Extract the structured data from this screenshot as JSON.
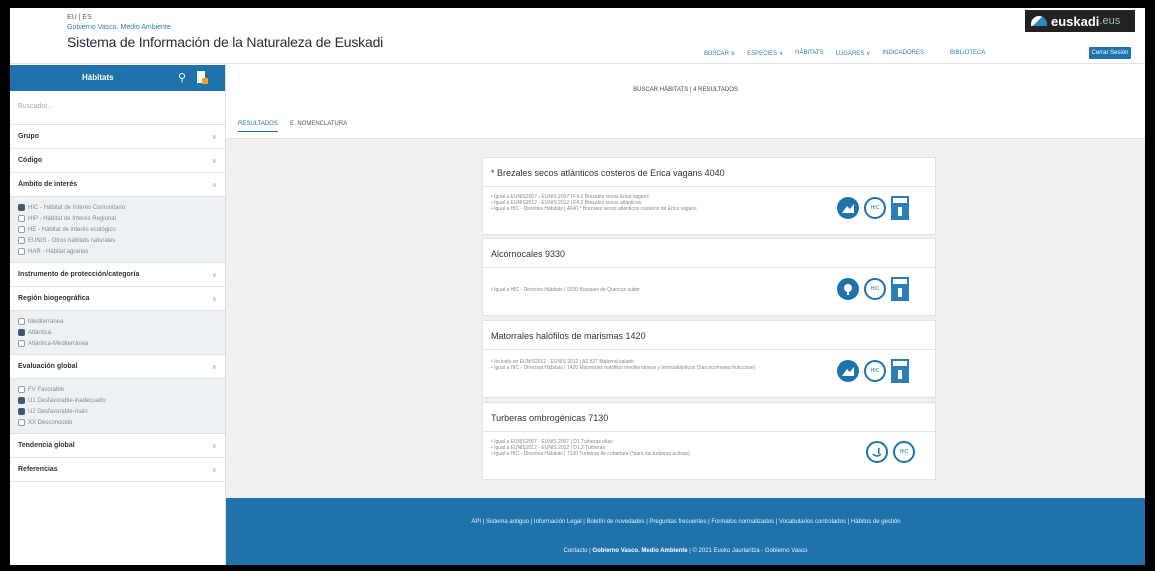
{
  "header": {
    "lang": "EU | ES",
    "gov": "Gobierno Vasco. Medio Ambiente",
    "title": "Sistema de Información de la Naturaleza de Euskadi",
    "logo_text": "euskadi",
    "logo_suffix": ".eus",
    "nav": [
      "Buscar ∨",
      "ESPECIES ∨",
      "HÁBITATS",
      "LUGARES ∨",
      "INDICADORES",
      "BIBLIOTECA"
    ],
    "session_button": "Cerrar Sesión"
  },
  "sidebar": {
    "title": "Hábitats",
    "search_placeholder": "Buscador...",
    "sections": {
      "grupo": "Grupo",
      "codigo": "Código",
      "ambito": "Ámbito de interés",
      "instrumento": "Instrumento de protección/categoría",
      "region": "Región biogeográfica",
      "evaluacion": "Evaluación global",
      "tendencia": "Tendencia global",
      "referencias": "Referencias"
    },
    "ambito_options": [
      {
        "label": "HIC - Hábitat de Interés Comunitario",
        "checked": true
      },
      {
        "label": "HIP - Hábitat de Interés Regional",
        "checked": false
      },
      {
        "label": "HE - Hábitat de interés ecológico",
        "checked": false
      },
      {
        "label": "EUNIS - Otros hábitats naturales",
        "checked": false
      },
      {
        "label": "HAR - Hábitat agrarios",
        "checked": false
      }
    ],
    "region_options": [
      {
        "label": "Mediterránea",
        "checked": false
      },
      {
        "label": "Atlántica",
        "checked": true
      },
      {
        "label": "Atlántica-Mediterránea",
        "checked": false
      }
    ],
    "evaluacion_options": [
      {
        "label": "FV Favorable",
        "checked": false
      },
      {
        "label": "U1 Desfavorable-inadecuado",
        "checked": true
      },
      {
        "label": "U2 Desfavorable-malo",
        "checked": true
      },
      {
        "label": "XX Desconocido",
        "checked": false
      }
    ]
  },
  "main": {
    "result_count": "BUSCAR HÁBITATS | 4 RESULTADOS",
    "tabs": [
      "RESULTADOS",
      "E. NOMENCLATURA"
    ],
    "cards": [
      {
        "title": "* Brezales secos atlánticos costeros de Erica vagans  4040",
        "lines": [
          "• Igual a EUNIS2007 - EUNIS 2007 | F4.2 Brezales secos Erica vagans",
          "• Igual a EUNIS2012 - EUNIS 2012 | F4.2 Brezales secos atlánticos",
          "• Igual a HIC - Directiva Hábitats | 4040 * Brezales secos atlánticos costeros de Erica vagans"
        ],
        "icons": [
          "habitat-icon",
          "hic-icon",
          "ficha-icon"
        ]
      },
      {
        "title": "Alcornocales  9330",
        "lines": [
          "• Igual a HIC - Directiva Hábitats | 9330 Bosques de Quercus suber"
        ],
        "icons": [
          "forest-icon",
          "hic-icon",
          "ficha-icon"
        ]
      },
      {
        "title": "Matorrales halófilos de marismas  1420",
        "lines": [
          "• Incluido en EUNIS2012 - EUNIS 2012 | A2.527 Matorral salado",
          "• Igual a HIC - Directiva Hábitats | 1420 Matorrales halófilos mediterráneos y termoatlánticos (Sarcocornetea fruticosae)"
        ],
        "icons": [
          "habitat-icon",
          "hic-icon",
          "ficha-icon"
        ]
      },
      {
        "title": "Turberas ombrogénicas  7130",
        "lines": [
          "• Igual a EUNIS2007 - EUNIS 2007 | D1 Turberas altas",
          "• Igual a EUNIS2012 - EUNIS 2012 | D1.2 Turberas",
          "• Igual a HIC - Directiva Hábitats | 7130 Turberas de cobertura (*para las turberas activas)"
        ],
        "icons": [
          "wetland-icon",
          "hic-icon"
        ]
      }
    ],
    "hic_label": "HIC"
  },
  "footer": {
    "links": "API | Sistema antiguo | Información Legal | Boletín de novedades | Preguntas frecuentes | Formatos normalizados | Vocabularios controlados | Hábitos de gestión",
    "contact": "Contacto",
    "org": "Gobierno Vasco. Medio Ambiente",
    "copyright": "© 2021 Eusko Jaurlaritza - Gobierno Vasco"
  },
  "colors": {
    "brand": "#1e73ab",
    "frame": "#000000"
  }
}
